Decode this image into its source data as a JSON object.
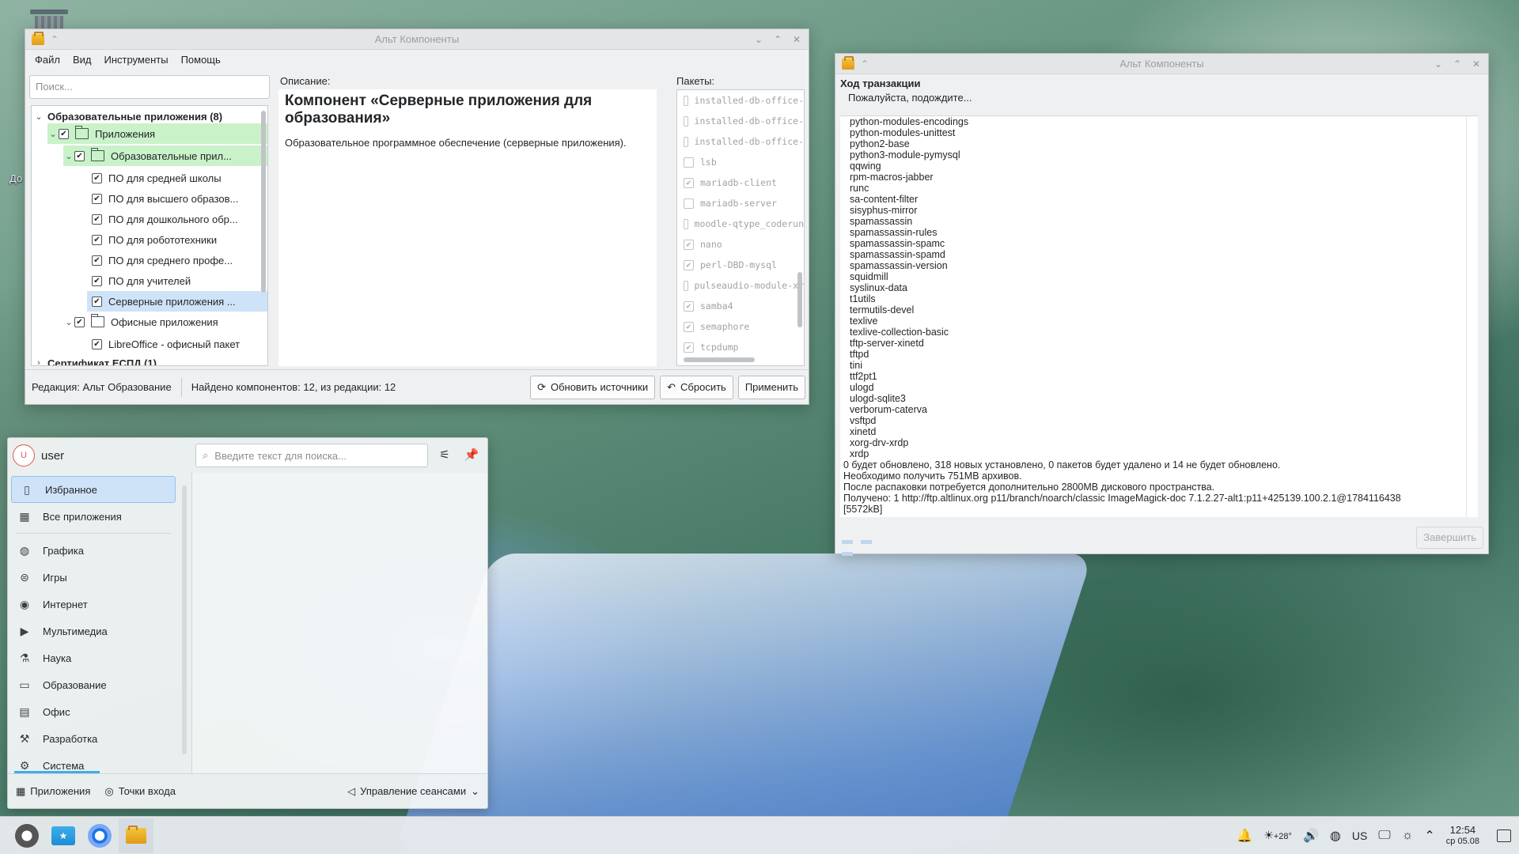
{
  "desktop": {
    "partial_label": "До"
  },
  "window_main": {
    "title": "Альт Компоненты",
    "controls": [
      "⌄",
      "⌃",
      "✕"
    ],
    "menu": [
      "Файл",
      "Вид",
      "Инструменты",
      "Помощь"
    ],
    "search_placeholder": "Поиск...",
    "tree": [
      {
        "label": "Образовательные приложения (8)",
        "bold": true
      },
      {
        "label": "Приложения"
      },
      {
        "label": "Образовательные прил..."
      },
      {
        "label": "ПО для средней школы"
      },
      {
        "label": "ПО для высшего образов..."
      },
      {
        "label": "ПО для дошкольного обр..."
      },
      {
        "label": "ПО для робототехники"
      },
      {
        "label": "ПО для среднего профе..."
      },
      {
        "label": "ПО для учителей"
      },
      {
        "label": "Серверные приложения ..."
      },
      {
        "label": "Офисные приложения"
      },
      {
        "label": "LibreOffice - офисный пакет"
      },
      {
        "label": "Сертификат ЕСПД (1)",
        "bold": true
      }
    ],
    "description_label": "Описание:",
    "description_title": "Компонент «Серверные приложения для образования»",
    "description_text": "Образовательное программное обеспечение (серверные приложения).",
    "packages_label": "Пакеты:",
    "packages": [
      {
        "name": "installed-db-office-",
        "checked": false
      },
      {
        "name": "installed-db-office-",
        "checked": false
      },
      {
        "name": "installed-db-office-",
        "checked": false
      },
      {
        "name": "lsb",
        "checked": false
      },
      {
        "name": "mariadb-client",
        "checked": true
      },
      {
        "name": "mariadb-server",
        "checked": false
      },
      {
        "name": "moodle-qtype_coderun",
        "checked": false
      },
      {
        "name": "nano",
        "checked": true
      },
      {
        "name": "perl-DBD-mysql",
        "checked": true
      },
      {
        "name": "pulseaudio-module-xr",
        "checked": false
      },
      {
        "name": "samba4",
        "checked": true
      },
      {
        "name": "semaphore",
        "checked": true
      },
      {
        "name": "tcpdump",
        "checked": true
      }
    ],
    "status": {
      "edition": "Редакция:  Альт Образование",
      "found": "Найдено компонентов: 12, из редакции: 12"
    },
    "buttons": {
      "refresh": "Обновить источники",
      "reset": "Сбросить",
      "apply": "Применить"
    }
  },
  "window_transaction": {
    "title": "Альт Компоненты",
    "controls": [
      "⌄",
      "⌃",
      "✕"
    ],
    "heading": "Ход транзакции",
    "subheading": "Пожалуйста, подождите...",
    "log_packages": [
      "python-modules-encodings",
      "python-modules-unittest",
      "python2-base",
      "python3-module-pymysql",
      "qqwing",
      "rpm-macros-jabber",
      "runc",
      "sa-content-filter",
      "sisyphus-mirror",
      "spamassassin",
      "spamassassin-rules",
      "spamassassin-spamc",
      "spamassassin-spamd",
      "spamassassin-version",
      "squidmill",
      "syslinux-data",
      "t1utils",
      "termutils-devel",
      "texlive",
      "texlive-collection-basic",
      "tftp-server-xinetd",
      "tftpd",
      "tini",
      "ttf2pt1",
      "ulogd",
      "ulogd-sqlite3",
      "verborum-caterva",
      "vsftpd",
      "xinetd",
      "xorg-drv-xrdp",
      "xrdp"
    ],
    "log_summary": [
      "0 будет обновлено, 318 новых установлено, 0 пакетов будет удалено и 14 не будет обновлено.",
      "Необходимо получить 751MB архивов.",
      "После распаковки потребуется дополнительно 2800MB дискового пространства.",
      "Получено: 1 http://ftp.altlinux.org p11/branch/noarch/classic ImageMagick-doc 7.1.2.27-alt1:p11+425139.100.2.1@1784116438",
      "[5572kB]"
    ],
    "finish_button": "Завершить"
  },
  "launcher": {
    "avatar_letter": "U",
    "user": "user",
    "search_placeholder": "Введите текст для поиска...",
    "categories": [
      {
        "label": "Избранное",
        "icon": "bookmark-icon",
        "glyph": "▯"
      },
      {
        "label": "Все приложения",
        "icon": "grid-icon",
        "glyph": "▦"
      },
      {
        "label": "Графика",
        "icon": "graphics-icon",
        "glyph": "◍"
      },
      {
        "label": "Игры",
        "icon": "gamepad-icon",
        "glyph": "⊜"
      },
      {
        "label": "Интернет",
        "icon": "globe-icon",
        "glyph": "◉"
      },
      {
        "label": "Мультимедиа",
        "icon": "monitor-play-icon",
        "glyph": "▶"
      },
      {
        "label": "Наука",
        "icon": "flask-icon",
        "glyph": "⚗"
      },
      {
        "label": "Образование",
        "icon": "education-icon",
        "glyph": "▭"
      },
      {
        "label": "Офис",
        "icon": "document-icon",
        "glyph": "▤"
      },
      {
        "label": "Разработка",
        "icon": "hammer-icon",
        "glyph": "⚒"
      },
      {
        "label": "Система",
        "icon": "gear-icon",
        "glyph": "⚙"
      }
    ],
    "bottom": {
      "apps": "Приложения",
      "places": "Точки входа",
      "sessions": "Управление сеансами"
    }
  },
  "taskbar": {
    "weather": "+28°",
    "layout": "US",
    "time": "12:54",
    "date": "ср 05.08"
  }
}
